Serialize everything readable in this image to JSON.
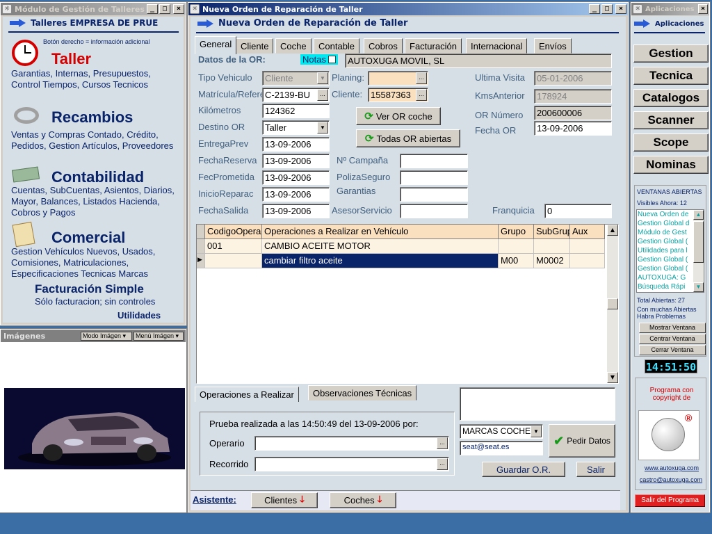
{
  "left_window": {
    "title": "Módulo de Gestión de Talleres",
    "company": "Talleres EMPRESA DE PRUE",
    "hint": "Botón derecho = información adicional",
    "modules": [
      {
        "name": "Taller",
        "desc": "Garantias, Internas, Presupuestos, Control Tiempos, Cursos Tecnicos"
      },
      {
        "name": "Recambios",
        "desc": "Ventas y Compras Contado, Crédito, Pedidos, Gestion Artículos, Proveedores"
      },
      {
        "name": "Contabilidad",
        "desc": "Cuentas, SubCuentas, Asientos, Diarios, Mayor, Balances, Listados Hacienda, Cobros y Pagos"
      },
      {
        "name": "Comercial",
        "desc": "Gestion Vehículos Nuevos, Usados, Comisiones, Matriculaciones, Especificaciones Tecnicas Marcas"
      }
    ],
    "fact_simple": "Facturación Simple",
    "fact_desc": "Sólo facturacion; sin controles",
    "utilidades": "Utilidades"
  },
  "images_panel": {
    "title": "Imágenes",
    "mode_btn": "Modo Imágen",
    "menu_btn": "Menú Imágen"
  },
  "main_window": {
    "title": "Nueva Orden de Reparación de Taller",
    "header": "Nueva Orden de Reparación de Taller",
    "tabs": [
      "General",
      "Cliente",
      "Coche",
      "Contable",
      "Cobros",
      "Facturación",
      "Internacional",
      "Envíos"
    ],
    "datos_or_label": "Datos de la OR:",
    "notas_label": "Notas",
    "client_name": "AUTOXUGA MOVIL, SL",
    "labels": {
      "tipo_vehiculo": "Tipo Vehiculo",
      "matricula": "Matrícula/Referencia",
      "kilometros": "Kilómetros",
      "destino": "Destino OR",
      "entrega_prev": "EntregaPrev",
      "fecha_reserva": "FechaReserva",
      "fec_prometida": "FecPrometida",
      "inicio_reparac": "InicioReparac",
      "fecha_salida": "FechaSalida",
      "planing": "Planing:",
      "cliente": "Cliente:",
      "ultima_visita": "Ultima Visita",
      "kms_anterior": "KmsAnterior",
      "or_numero": "OR Número",
      "fecha_or": "Fecha OR",
      "n_campana": "Nº Campaña",
      "poliza_seguro": "PolizaSeguro",
      "garantias": "Garantias",
      "asesor": "AsesorServicio",
      "franquicia": "Franquicia"
    },
    "values": {
      "tipo_vehiculo": "Cliente",
      "matricula": "C-2139-BU",
      "kilometros": "124362",
      "destino": "Taller",
      "entrega_prev": "13-09-2006",
      "fecha_reserva": "13-09-2006",
      "fec_prometida": "13-09-2006",
      "inicio_reparac": "13-09-2006",
      "fecha_salida": "13-09-2006",
      "cliente": "15587363",
      "ultima_visita": "05-01-2006",
      "kms_anterior": "178924",
      "or_numero": "200600006",
      "fecha_or": "13-09-2006",
      "franquicia": "0"
    },
    "ver_or_coche": "Ver OR coche",
    "todas_or": "Todas OR abiertas",
    "grid": {
      "headers": [
        "CodigoOperación",
        "Operaciones a Realizar en Vehículo",
        "Grupo",
        "SubGrupo",
        "Aux"
      ],
      "rows": [
        [
          "001",
          "CAMBIO ACEITE MOTOR",
          "",
          "",
          ""
        ],
        [
          "",
          "cambiar filtro aceite",
          "M00",
          "M0002",
          ""
        ]
      ]
    },
    "bottom_tabs": [
      "Operaciones a Realizar",
      "Observaciones Técnicas"
    ],
    "prueba_text": "Prueba realizada a las 14:50:49 del 13-09-2006 por:",
    "operario_label": "Operario",
    "recorrido_label": "Recorrido",
    "marcas_select": "MARCAS COCHES",
    "email": "seat@seat.es",
    "pedir_datos": "Pedir Datos",
    "guardar": "Guardar O.R.",
    "salir": "Salir",
    "asistente": "Asistente:",
    "clientes_btn": "Clientes",
    "coches_btn": "Coches"
  },
  "right_window": {
    "title": "Aplicaciones",
    "header": "Aplicaciones",
    "apps": [
      "Gestion",
      "Tecnica",
      "Catalogos",
      "Scanner",
      "Scope",
      "Nominas"
    ],
    "ventanas_title": "VENTANAS ABIERTAS",
    "visibles": "Visibles Ahora: 12",
    "open_windows": [
      "Nueva Orden de",
      "Gestion Global d",
      "Módulo de Gest",
      "Gestion Global (",
      "Utilidades para l",
      "Gestion Global (",
      "Gestion Global (",
      "AUTOXUGA: G",
      "Búsqueda Rápi"
    ],
    "total": "Total Abiertas: 27",
    "warning": "Con muchas Abiertas Habra Problemas",
    "mostrar": "Mostrar Ventana",
    "centrar": "Centrar Ventana",
    "cerrar": "Cerrar Ventana",
    "clock": "14:51:50",
    "copyright": "Programa con copyright de",
    "web": "www.autoxuga.com",
    "mail": "castro@autoxuga.com",
    "salir_programa": "Salir del Programa"
  },
  "colors": {
    "title_active": "#0a246a",
    "panel_bg": "#d6dee6",
    "heading": "#0a246a",
    "accent_red": "#d40000",
    "clock_bg": "#000000",
    "clock_fg": "#40e0ff"
  }
}
